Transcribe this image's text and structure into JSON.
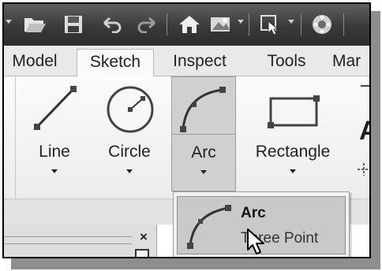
{
  "tabs": [
    {
      "label": "Model"
    },
    {
      "label": "Sketch"
    },
    {
      "label": "Inspect"
    },
    {
      "label": "Tools"
    },
    {
      "label": "Mar"
    }
  ],
  "active_tab": "Sketch",
  "tools": {
    "line": {
      "label": "Line"
    },
    "circle": {
      "label": "Circle"
    },
    "arc": {
      "label": "Arc"
    },
    "rectangle": {
      "label": "Rectangle"
    },
    "partial_letter": "A"
  },
  "dropdown": {
    "title": "Arc",
    "subtitle": "Three Point"
  },
  "palette": {
    "close_glyph": "×"
  },
  "quick_access_icons": [
    "new-dropdown-icon",
    "open-icon",
    "save-icon",
    "undo-icon",
    "redo-icon",
    "home-icon",
    "appearance-icon",
    "select-icon",
    "materials-icon"
  ],
  "colors": {
    "toolbar_dark": "#3a3a3a",
    "ribbon_bg": "#f4f4f4",
    "highlight": "#d0d0d0"
  }
}
